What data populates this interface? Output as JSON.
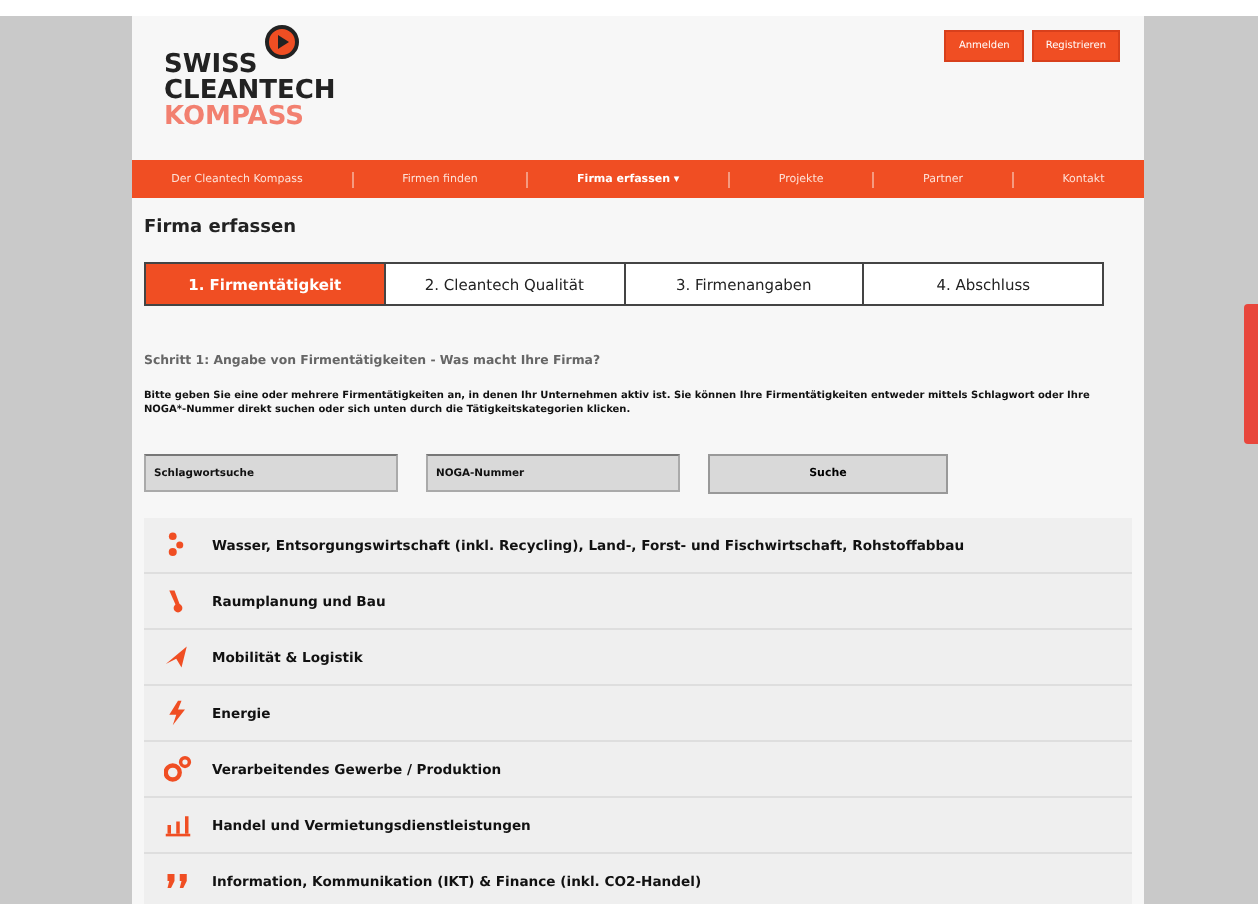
{
  "logo": {
    "line_1": "SWISS",
    "line_2": "CLEANTECH",
    "line_3": "KOMPASS"
  },
  "header_buttons": [
    "Anmelden",
    "Registrieren"
  ],
  "nav": [
    {
      "label": "Der Cleantech Kompass",
      "selected": false
    },
    {
      "label": "Firmen finden",
      "selected": false
    },
    {
      "label": "Firma erfassen ▾",
      "selected": true
    },
    {
      "label": "Projekte",
      "selected": false
    },
    {
      "label": "Partner",
      "selected": false
    },
    {
      "label": "Kontakt",
      "selected": false
    }
  ],
  "page_title": "Firma erfassen",
  "steps": [
    {
      "label": "1. Firmentätigkeit",
      "selected": true
    },
    {
      "label": "2. Cleantech Qualität",
      "selected": false
    },
    {
      "label": "3. Firmenangaben",
      "selected": false
    },
    {
      "label": "4. Abschluss",
      "selected": false
    }
  ],
  "step_heading": "Schritt 1: Angabe von Firmentätigkeiten - Was macht Ihre Firma?",
  "intro": "Bitte geben Sie eine oder mehrere Firmentätigkeiten an, in denen Ihr Unternehmen aktiv ist. Sie können Ihre Firmentätigkeiten entweder mittels Schlagwort oder Ihre NOGA*-Nummer direkt suchen oder sich unten durch die Tätigkeitskategorien klicken.",
  "search": {
    "keyword_placeholder": "Schlagwortsuche",
    "noga_placeholder": "NOGA-Nummer",
    "button": "Suche"
  },
  "categories": [
    {
      "kind": "water",
      "label": "Wasser, Entsorgungswirtschaft (inkl. Recycling), Land-, Forst- und Fischwirtschaft, Rohstoffabbau"
    },
    {
      "kind": "construction",
      "label": "Raumplanung und Bau"
    },
    {
      "kind": "mobility",
      "label": "Mobilität & Logistik"
    },
    {
      "kind": "energy",
      "label": "Energie"
    },
    {
      "kind": "production",
      "label": "Verarbeitendes Gewerbe / Produktion"
    },
    {
      "kind": "trade",
      "label": "Handel und Vermietungsdienstleistungen"
    },
    {
      "kind": "information",
      "label": "Information, Kommunikation (IKT) & Finance (inkl. CO2-Handel)"
    }
  ]
}
